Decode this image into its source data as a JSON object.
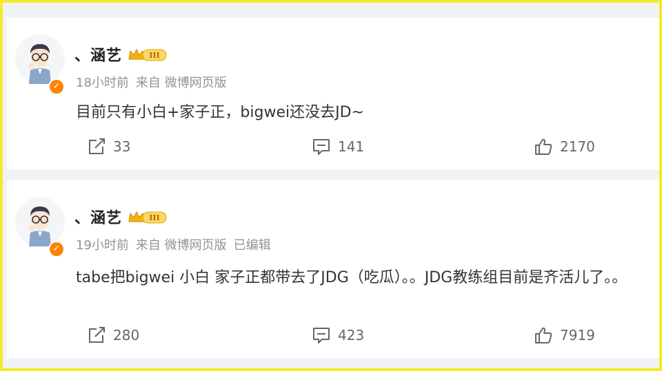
{
  "posts": [
    {
      "username": "、涵艺",
      "vip_level": "III",
      "time": "18小时前",
      "source": "来自 微博网页版",
      "edited": "",
      "content": "目前只有小白+家子正，bigwei还没去JD~",
      "reposts": "33",
      "comments": "141",
      "likes": "2170"
    },
    {
      "username": "、涵艺",
      "vip_level": "III",
      "time": "19小时前",
      "source": "来自 微博网页版",
      "edited": "已编辑",
      "content": "tabe把bigwei 小白 家子正都带去了JDG（吃瓜）。。JDG教练组目前是齐活儿了。。",
      "reposts": "280",
      "comments": "423",
      "likes": "7919"
    }
  ],
  "icons": {
    "repost": "repost-icon",
    "comment": "comment-icon",
    "like": "like-icon",
    "verified": "verified-badge-icon",
    "vip": "vip-crown-icon"
  },
  "colors": {
    "frame": "#f4ea2a",
    "verified": "#ff8200",
    "meta_text": "#939393",
    "vip_gold": "#f5b400"
  }
}
